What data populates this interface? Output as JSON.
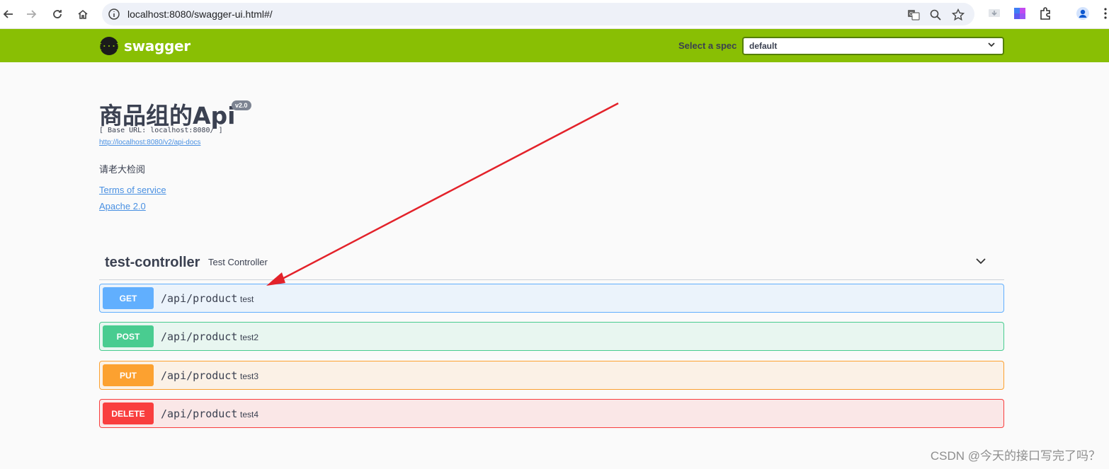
{
  "browser": {
    "url": "localhost:8080/swagger-ui.html#/"
  },
  "topbar": {
    "logo_symbol": "{···}",
    "logo_text": "swagger",
    "spec_label": "Select a spec",
    "spec_value": "default"
  },
  "info": {
    "title": "商品组的Api",
    "version": "v2.0",
    "base_url": "[ Base URL: localhost:8080/ ]",
    "api_docs_link": "http://localhost:8080/v2/api-docs",
    "description": "请老大检阅",
    "terms_link": "Terms of service",
    "license_link": "Apache 2.0"
  },
  "controller": {
    "name": "test-controller",
    "description": "Test Controller"
  },
  "operations": [
    {
      "method": "GET",
      "path": "/api/product",
      "summary": "test",
      "color": "#61affe",
      "bg": "#ebf3fb",
      "border": "#61affe"
    },
    {
      "method": "POST",
      "path": "/api/product",
      "summary": "test2",
      "color": "#49cc90",
      "bg": "#e8f6f0",
      "border": "#49cc90"
    },
    {
      "method": "PUT",
      "path": "/api/product",
      "summary": "test3",
      "color": "#fca130",
      "bg": "#fbf1e6",
      "border": "#fca130"
    },
    {
      "method": "DELETE",
      "path": "/api/product",
      "summary": "test4",
      "color": "#f93e3e",
      "bg": "#fae7e7",
      "border": "#f93e3e"
    }
  ],
  "watermark": "CSDN @今天的接口写完了吗？",
  "colors": {
    "topbar": "#89bf04",
    "link": "#4990e2",
    "annotation_arrow": "#e3222a"
  }
}
